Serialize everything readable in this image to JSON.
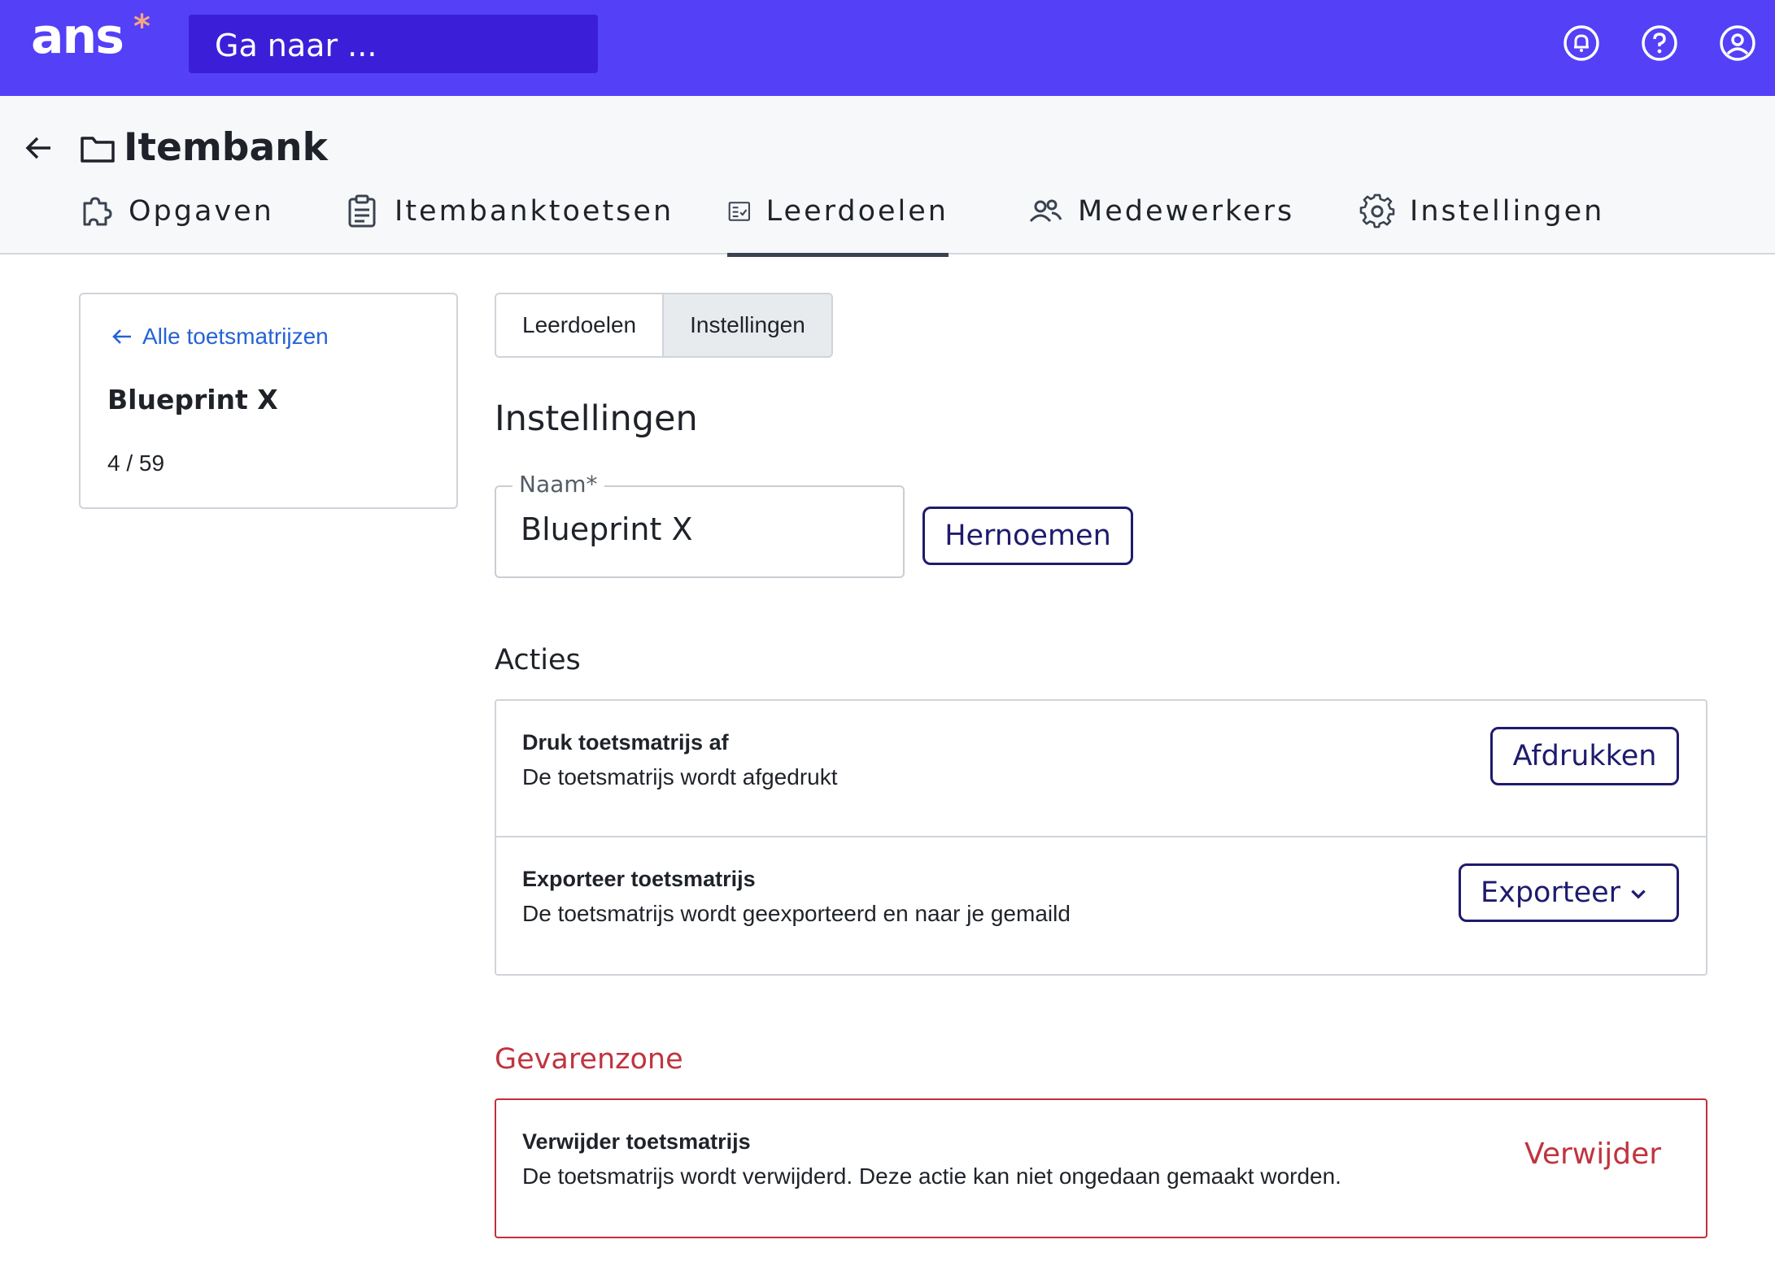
{
  "topbar": {
    "logo": "ans",
    "logo_mark": "*",
    "search_placeholder": "Ga naar ...",
    "icons": [
      "notification-bell-icon",
      "help-icon",
      "account-icon"
    ]
  },
  "header": {
    "title": "Itembank",
    "tabs": [
      {
        "label": "Opgaven",
        "icon": "puzzle-icon",
        "active": false
      },
      {
        "label": "Itembanktoetsen",
        "icon": "clipboard-icon",
        "active": false
      },
      {
        "label": "Leerdoelen",
        "icon": "checklist-icon",
        "active": true
      },
      {
        "label": "Medewerkers",
        "icon": "users-icon",
        "active": false
      },
      {
        "label": "Instellingen",
        "icon": "gear-icon",
        "active": false
      }
    ]
  },
  "sidebar": {
    "back_link": "Alle toetsmatrijzen",
    "title": "Blueprint X",
    "count": "4 / 59"
  },
  "subtabs": {
    "items": [
      "Leerdoelen",
      "Instellingen"
    ],
    "selected": "Instellingen"
  },
  "settings": {
    "heading": "Instellingen",
    "name_label": "Naam*",
    "name_value": "Blueprint X",
    "rename_button": "Hernoemen"
  },
  "actions": {
    "heading": "Acties",
    "print": {
      "title": "Druk toetsmatrijs af",
      "description": "De toetsmatrijs wordt afgedrukt",
      "button": "Afdrukken"
    },
    "export": {
      "title": "Exporteer toetsmatrijs",
      "description": "De toetsmatrijs wordt geexporteerd en naar je gemaild",
      "button": "Exporteer"
    }
  },
  "danger": {
    "heading": "Gevarenzone",
    "delete": {
      "title": "Verwijder toetsmatrijs",
      "description": "De toetsmatrijs wordt verwijderd. Deze actie kan niet ongedaan gemaakt worden.",
      "button": "Verwijder"
    }
  },
  "colors": {
    "topbar": "#5340f7",
    "search": "#3b1fd8",
    "accent_dark": "#1e1b6e",
    "link": "#2563d6",
    "danger": "#c0343f"
  }
}
